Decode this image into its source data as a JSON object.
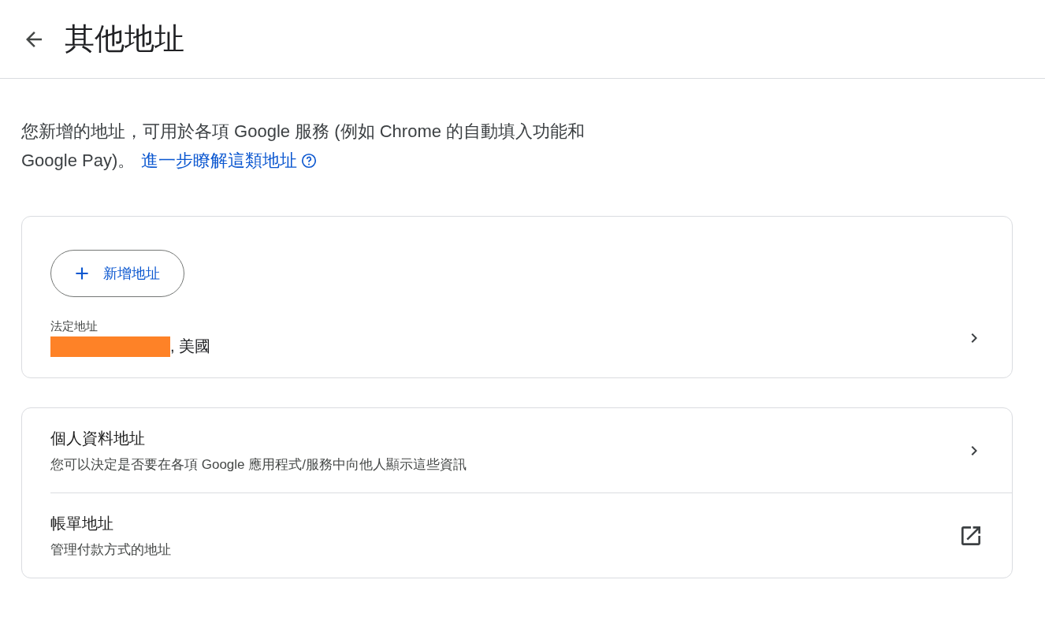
{
  "header": {
    "title": "其他地址"
  },
  "intro": {
    "text": "您新增的地址，可用於各項 Google 服務 (例如 Chrome 的自動填入功能和 Google Pay)。",
    "link": "進一步瞭解這類地址"
  },
  "address_card": {
    "add_button": "新增地址",
    "legal": {
      "label": "法定地址",
      "value": ", 美國",
      "redacted": true
    }
  },
  "links": [
    {
      "kind": "internal",
      "title": "個人資料地址",
      "subtitle": "您可以決定是否要在各項 Google 應用程式/服務中向他人顯示這些資訊"
    },
    {
      "kind": "external",
      "title": "帳單地址",
      "subtitle": "管理付款方式的地址"
    }
  ]
}
